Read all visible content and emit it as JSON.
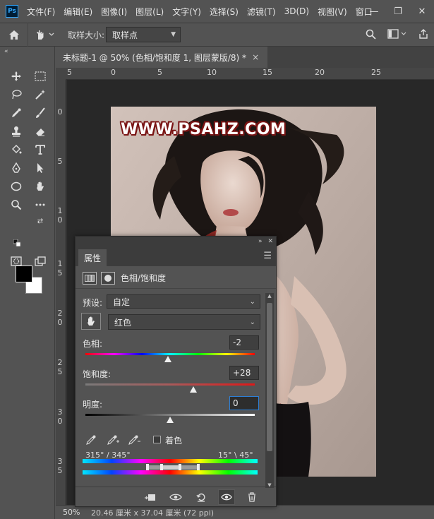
{
  "app": {
    "logo": "Ps"
  },
  "menu": [
    "文件(F)",
    "编辑(E)",
    "图像(I)",
    "图层(L)",
    "文字(Y)",
    "选择(S)",
    "滤镜(T)",
    "3D(D)",
    "视图(V)",
    "窗口"
  ],
  "window_controls": {
    "minimize": "—",
    "restore": "❐",
    "close": "✕"
  },
  "options": {
    "sample_size_label": "取样大小:",
    "sample_size_value": "取样点"
  },
  "document": {
    "tab_title": "未标题-1 @ 50% (色相/饱和度 1, 图层蒙版/8) *",
    "close": "×",
    "watermark": "WWW.PSAHZ.COM",
    "zoom": "50%",
    "status_info": "20.46 厘米 x 37.04 厘米 (72 ppi)"
  },
  "rulers": {
    "top": [
      "5",
      "0",
      "5",
      "10",
      "15",
      "20",
      "25"
    ],
    "left": [
      [
        "0"
      ],
      [
        "5"
      ],
      [
        "1",
        "0"
      ],
      [
        "1",
        "5"
      ],
      [
        "2",
        "0"
      ],
      [
        "2",
        "5"
      ],
      [
        "3",
        "0"
      ],
      [
        "3",
        "5"
      ]
    ]
  },
  "colors": {
    "foreground": "#000000",
    "background": "#ffffff",
    "accent": "#2d7fd6"
  },
  "properties": {
    "tab": "属性",
    "header_title": "色相/饱和度",
    "preset_label": "预设:",
    "preset_value": "自定",
    "channel_value": "红色",
    "hue_label": "色相:",
    "hue_value": "-2",
    "saturation_label": "饱和度:",
    "saturation_value": "+28",
    "lightness_label": "明度:",
    "lightness_value": "0",
    "colorize_label": "着色",
    "range_left": "315° / 345°",
    "range_right": "15° \\ 45°"
  }
}
